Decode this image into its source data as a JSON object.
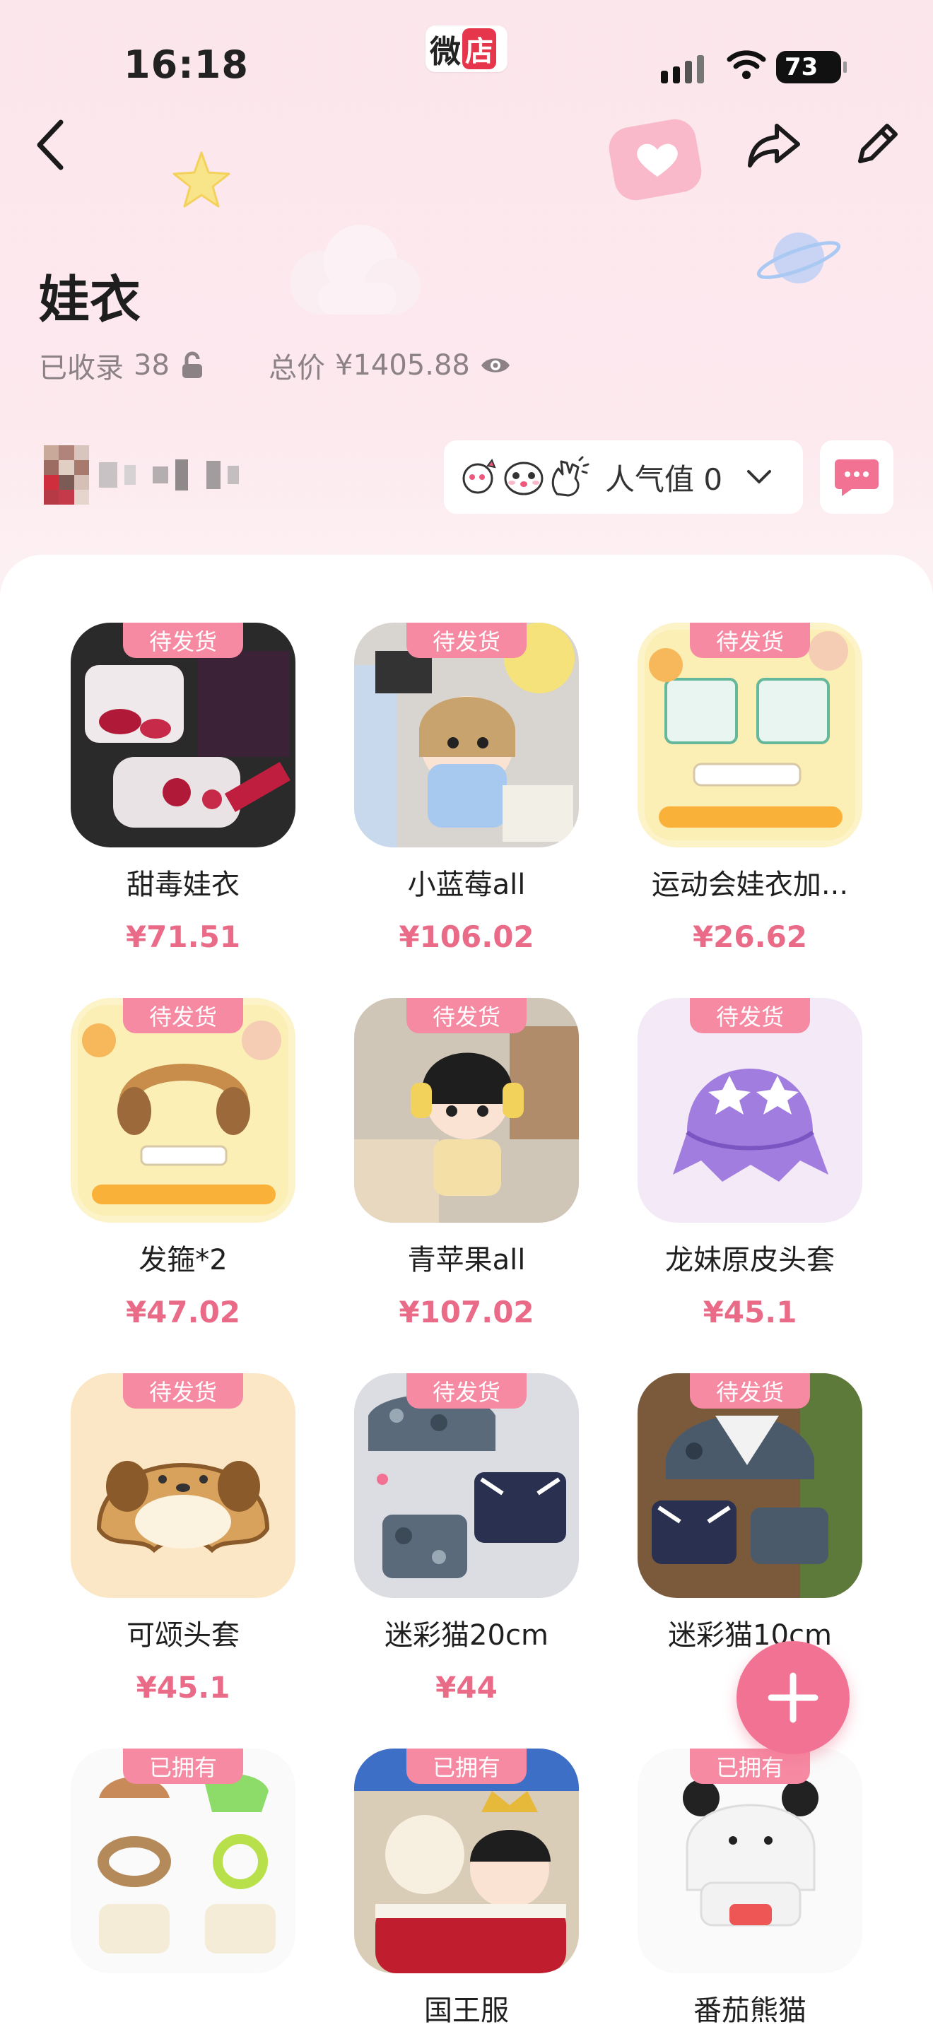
{
  "status_bar": {
    "time": "16:18",
    "battery": "73",
    "app_logo": [
      "微",
      "店"
    ]
  },
  "header": {
    "title": "娃衣",
    "collected_label": "已收录",
    "collected_count": "38",
    "total_label": "总价",
    "total_value": "¥1405.88"
  },
  "popularity": {
    "label": "人气值 0"
  },
  "items": [
    {
      "name": "甜毒娃衣",
      "price": "¥71.51",
      "badge": "待发货"
    },
    {
      "name": "小蓝莓all",
      "price": "¥106.02",
      "badge": "待发货"
    },
    {
      "name": "运动会娃衣加...",
      "price": "¥26.62",
      "badge": "待发货"
    },
    {
      "name": "发箍*2",
      "price": "¥47.02",
      "badge": "待发货"
    },
    {
      "name": "青苹果all",
      "price": "¥107.02",
      "badge": "待发货"
    },
    {
      "name": "龙妹原皮头套",
      "price": "¥45.1",
      "badge": "待发货"
    },
    {
      "name": "可颂头套",
      "price": "¥45.1",
      "badge": "待发货"
    },
    {
      "name": "迷彩猫20cm",
      "price": "¥44",
      "badge": "待发货"
    },
    {
      "name": "迷彩猫10cm",
      "price": "¥",
      "badge": "待发货"
    },
    {
      "name": "",
      "price": "",
      "badge": "已拥有"
    },
    {
      "name": "国王服",
      "price": "",
      "badge": "已拥有"
    },
    {
      "name": "番茄熊猫",
      "price": "",
      "badge": "已拥有"
    }
  ],
  "colors": {
    "accent": "#f27293",
    "badge": "#f68aa3",
    "price": "#ea6b88",
    "background": "#fbe6ec"
  },
  "icons": [
    "back-arrow-icon",
    "share-icon",
    "edit-pencil-icon",
    "lock-open-icon",
    "eye-icon",
    "chevron-down-icon",
    "chat-bubble-icon",
    "plus-icon"
  ]
}
